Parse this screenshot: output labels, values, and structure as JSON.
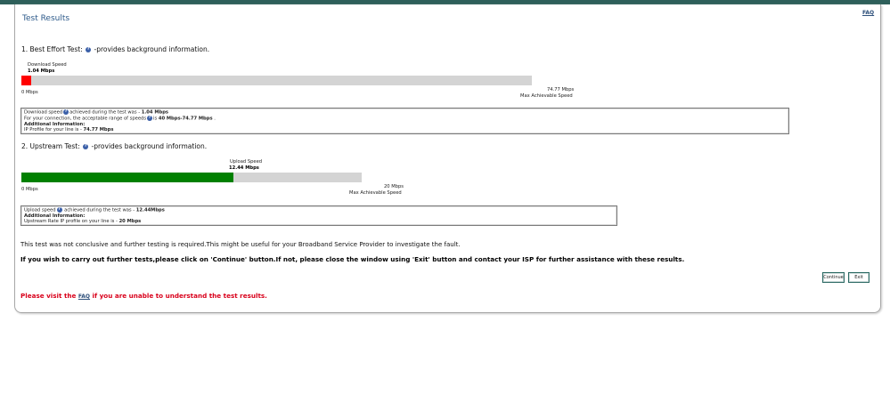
{
  "header": {
    "title": "Test Results",
    "faq_link": "FAQ"
  },
  "best_effort": {
    "heading_prefix": "1. Best Effort Test:",
    "heading_suffix": "-provides background information.",
    "gauge_label": "Download Speed",
    "gauge_value": "1.04 Mbps",
    "min_label": "0 Mbps",
    "max_value": "74.77 Mbps",
    "max_caption": "Max Achievable Speed",
    "fill_fraction": 0.019,
    "fill_color": "#ff0000",
    "info": {
      "line1_prefix": "Download speed",
      "line1_mid": "achieved during the test was - ",
      "line1_value": "1.04 Mbps",
      "line2_prefix": "For your connection, the acceptable range of speeds",
      "line2_mid": "is ",
      "line2_value": "40 Mbps-74.77 Mbps",
      "line2_suffix": " .",
      "line3": "Additional Information:",
      "line4_prefix": "IP Profile for your line is - ",
      "line4_value": "74.77 Mbps"
    }
  },
  "upstream": {
    "heading_prefix": "2. Upstream Test:",
    "heading_suffix": "-provides background information.",
    "gauge_label": "Upload Speed",
    "gauge_value": "12.44 Mbps",
    "min_label": "0 Mbps",
    "max_value": "20 Mbps",
    "max_caption": "Max Achievable Speed",
    "fill_fraction": 0.622,
    "fill_color": "#008000",
    "info": {
      "line1_prefix": "Upload speed",
      "line1_mid": " achieved during the test was - ",
      "line1_value": "12.44Mbps",
      "line2": "Additional Information:",
      "line3_prefix": "Upstream Rate IP profile on your line is - ",
      "line3_value": "20 Mbps"
    }
  },
  "messages": {
    "inconclusive": "This test was not conclusive and further testing is required.This might be useful for your Broadband Service Provider to investigate the fault.",
    "instruction": "If you wish to carry out further tests,please click on 'Continue' button.If not, please close the window using 'Exit' button and contact your ISP for further assistance with these results.",
    "faq_prefix": "Please visit the ",
    "faq_link": "FAQ",
    "faq_suffix": " if you are unable to understand the test results."
  },
  "buttons": {
    "continue": "Continue",
    "exit": "Exit"
  },
  "icons": {
    "info": "info-icon"
  },
  "colors": {
    "topbar": "#2e5f5a",
    "title": "#2d5a8a",
    "error": "#d9001b"
  }
}
